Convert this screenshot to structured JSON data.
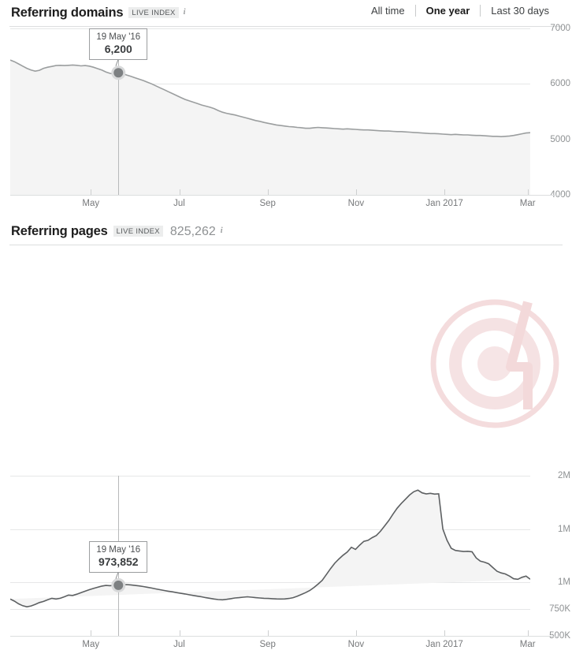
{
  "range_switch": {
    "items": [
      {
        "label": "All time",
        "active": false
      },
      {
        "label": "One year",
        "active": true
      },
      {
        "label": "Last 30 days",
        "active": false
      }
    ]
  },
  "panels": [
    {
      "id": "domains",
      "title": "Referring domains",
      "badge": "LIVE INDEX",
      "value": "",
      "info_icon": "info-icon"
    },
    {
      "id": "pages",
      "title": "Referring pages",
      "badge": "LIVE INDEX",
      "value": "825,262",
      "info_icon": "info-icon"
    }
  ],
  "chart_data": [
    {
      "type": "area",
      "title": "Referring domains",
      "xlabel": "",
      "ylabel": "",
      "grid": true,
      "legend": null,
      "ylim": [
        4000,
        7000
      ],
      "yticks": [
        7000,
        6000,
        5000,
        4000
      ],
      "ytick_labels": [
        "7000",
        "6000",
        "5000",
        "4000"
      ],
      "xticks": [
        "May",
        "Jul",
        "Sep",
        "Nov",
        "Jan 2017",
        "Mar"
      ],
      "xtick_positions": [
        0.155,
        0.325,
        0.495,
        0.665,
        0.835,
        0.995
      ],
      "annotation": {
        "date": "19 May '16",
        "value": "6,200",
        "x_frac": 0.208,
        "y_value": 6200
      },
      "x": [
        0.0,
        0.008,
        0.016,
        0.024,
        0.032,
        0.04,
        0.048,
        0.056,
        0.064,
        0.072,
        0.08,
        0.088,
        0.096,
        0.104,
        0.112,
        0.12,
        0.128,
        0.136,
        0.144,
        0.152,
        0.16,
        0.168,
        0.176,
        0.184,
        0.192,
        0.2,
        0.208,
        0.216,
        0.224,
        0.232,
        0.24,
        0.248,
        0.256,
        0.264,
        0.272,
        0.28,
        0.288,
        0.296,
        0.304,
        0.312,
        0.32,
        0.328,
        0.336,
        0.344,
        0.352,
        0.36,
        0.368,
        0.376,
        0.384,
        0.392,
        0.4,
        0.408,
        0.416,
        0.424,
        0.432,
        0.44,
        0.448,
        0.456,
        0.464,
        0.472,
        0.48,
        0.488,
        0.496,
        0.504,
        0.512,
        0.52,
        0.528,
        0.536,
        0.544,
        0.552,
        0.56,
        0.568,
        0.576,
        0.584,
        0.592,
        0.6,
        0.608,
        0.616,
        0.624,
        0.632,
        0.64,
        0.648,
        0.656,
        0.664,
        0.672,
        0.68,
        0.688,
        0.696,
        0.704,
        0.712,
        0.72,
        0.728,
        0.736,
        0.744,
        0.752,
        0.76,
        0.768,
        0.776,
        0.784,
        0.792,
        0.8,
        0.808,
        0.816,
        0.824,
        0.832,
        0.84,
        0.848,
        0.856,
        0.864,
        0.872,
        0.88,
        0.888,
        0.896,
        0.904,
        0.912,
        0.92,
        0.928,
        0.936,
        0.944,
        0.952,
        0.96,
        0.968,
        0.976,
        0.984,
        0.992,
        1.0
      ],
      "values": [
        6430,
        6400,
        6360,
        6320,
        6280,
        6250,
        6230,
        6245,
        6280,
        6300,
        6315,
        6330,
        6335,
        6330,
        6335,
        6340,
        6335,
        6325,
        6330,
        6320,
        6300,
        6275,
        6250,
        6215,
        6190,
        6175,
        6200,
        6185,
        6160,
        6135,
        6110,
        6085,
        6060,
        6030,
        6000,
        5965,
        5930,
        5895,
        5860,
        5825,
        5790,
        5755,
        5720,
        5695,
        5670,
        5645,
        5620,
        5600,
        5580,
        5555,
        5520,
        5490,
        5470,
        5455,
        5440,
        5420,
        5400,
        5380,
        5360,
        5340,
        5325,
        5305,
        5290,
        5275,
        5260,
        5250,
        5240,
        5230,
        5225,
        5215,
        5210,
        5200,
        5200,
        5210,
        5215,
        5210,
        5205,
        5200,
        5195,
        5190,
        5185,
        5190,
        5185,
        5180,
        5175,
        5170,
        5170,
        5165,
        5160,
        5155,
        5150,
        5150,
        5145,
        5140,
        5140,
        5135,
        5130,
        5125,
        5120,
        5115,
        5110,
        5105,
        5105,
        5100,
        5095,
        5090,
        5085,
        5090,
        5085,
        5080,
        5080,
        5075,
        5070,
        5070,
        5065,
        5060,
        5055,
        5055,
        5050,
        5055,
        5060,
        5070,
        5085,
        5100,
        5115,
        5120
      ]
    },
    {
      "type": "area",
      "title": "Referring pages",
      "xlabel": "",
      "ylabel": "",
      "grid": true,
      "legend": null,
      "ylim": [
        500000,
        2000000
      ],
      "yticks": [
        2000000,
        1500000,
        1000000,
        750000,
        500000
      ],
      "ytick_labels": [
        "2M",
        "1M",
        "1M",
        "750K",
        "500K"
      ],
      "xticks": [
        "May",
        "Jul",
        "Sep",
        "Nov",
        "Jan 2017",
        "Mar"
      ],
      "xtick_positions": [
        0.155,
        0.325,
        0.495,
        0.665,
        0.835,
        0.995
      ],
      "annotation": {
        "date": "19 May '16",
        "value": "973,852",
        "x_frac": 0.208,
        "y_value": 973852
      },
      "x": [
        0.0,
        0.008,
        0.016,
        0.024,
        0.032,
        0.04,
        0.048,
        0.056,
        0.064,
        0.072,
        0.08,
        0.088,
        0.096,
        0.104,
        0.112,
        0.12,
        0.128,
        0.136,
        0.144,
        0.152,
        0.16,
        0.168,
        0.176,
        0.184,
        0.192,
        0.2,
        0.208,
        0.216,
        0.224,
        0.232,
        0.24,
        0.248,
        0.256,
        0.264,
        0.272,
        0.28,
        0.288,
        0.296,
        0.304,
        0.312,
        0.32,
        0.328,
        0.336,
        0.344,
        0.352,
        0.36,
        0.368,
        0.376,
        0.384,
        0.392,
        0.4,
        0.408,
        0.416,
        0.424,
        0.432,
        0.44,
        0.448,
        0.456,
        0.464,
        0.472,
        0.48,
        0.488,
        0.496,
        0.504,
        0.512,
        0.52,
        0.528,
        0.536,
        0.544,
        0.552,
        0.56,
        0.568,
        0.576,
        0.584,
        0.592,
        0.6,
        0.608,
        0.616,
        0.624,
        0.632,
        0.64,
        0.648,
        0.656,
        0.664,
        0.672,
        0.68,
        0.688,
        0.696,
        0.704,
        0.712,
        0.72,
        0.728,
        0.736,
        0.744,
        0.752,
        0.76,
        0.768,
        0.776,
        0.784,
        0.792,
        0.8,
        0.808,
        0.816,
        0.824,
        0.832,
        0.84,
        0.848,
        0.856,
        0.864,
        0.872,
        0.88,
        0.888,
        0.896,
        0.904,
        0.912,
        0.92,
        0.928,
        0.936,
        0.944,
        0.952,
        0.96,
        0.968,
        0.976,
        0.984,
        0.992,
        1.0
      ],
      "values": [
        845000,
        825000,
        800000,
        782000,
        772000,
        780000,
        795000,
        812000,
        822000,
        838000,
        852000,
        845000,
        852000,
        866000,
        882000,
        878000,
        890000,
        905000,
        918000,
        932000,
        944000,
        955000,
        966000,
        972000,
        970000,
        973852,
        976000,
        978000,
        980000,
        977000,
        972000,
        968000,
        962000,
        955000,
        948000,
        940000,
        932000,
        925000,
        918000,
        912000,
        905000,
        898000,
        892000,
        885000,
        878000,
        872000,
        866000,
        858000,
        852000,
        845000,
        840000,
        838000,
        842000,
        848000,
        855000,
        858000,
        862000,
        866000,
        862000,
        858000,
        855000,
        852000,
        850000,
        848000,
        846000,
        845000,
        846000,
        850000,
        858000,
        872000,
        888000,
        905000,
        925000,
        952000,
        985000,
        1020000,
        1075000,
        1130000,
        1180000,
        1220000,
        1255000,
        1285000,
        1330000,
        1310000,
        1350000,
        1385000,
        1395000,
        1420000,
        1440000,
        1480000,
        1530000,
        1580000,
        1640000,
        1695000,
        1740000,
        1780000,
        1820000,
        1850000,
        1865000,
        1840000,
        1830000,
        1835000,
        1828000,
        1830000,
        1500000,
        1395000,
        1320000,
        1300000,
        1295000,
        1290000,
        1292000,
        1288000,
        1230000,
        1200000,
        1190000,
        1175000,
        1140000,
        1105000,
        1090000,
        1080000,
        1060000,
        1035000,
        1030000,
        1048000,
        1060000,
        1030000,
        1000000,
        975000,
        962000
      ]
    }
  ]
}
